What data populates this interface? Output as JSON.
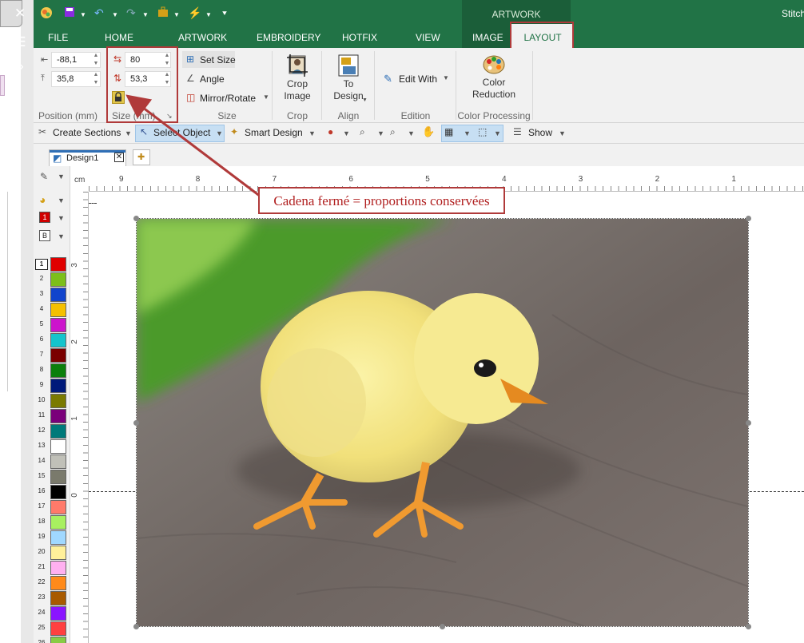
{
  "app": {
    "title_partial": "Stitch"
  },
  "tabs": [
    {
      "label": "FILE"
    },
    {
      "label": "HOME"
    },
    {
      "label": "ARTWORK"
    },
    {
      "label": "EMBROIDERY"
    },
    {
      "label": "HOTFIX"
    },
    {
      "label": "VIEW"
    },
    {
      "label": "IMAGE"
    },
    {
      "label": "LAYOUT"
    }
  ],
  "context_tab_group": "ARTWORK",
  "ribbon": {
    "position": {
      "x": "-88,1",
      "y": "35,8",
      "group_label": "Position (mm)"
    },
    "size": {
      "width": "80",
      "height": "53,3",
      "group_label": "Size (mm)",
      "lock_icon": "padlock-closed-icon"
    },
    "size_tools": {
      "set_size": "Set Size",
      "angle": "Angle",
      "mirror_rotate": "Mirror/Rotate",
      "group_label": "Size"
    },
    "crop": {
      "button_line1": "Crop",
      "button_line2": "Image",
      "group_label": "Crop"
    },
    "align": {
      "button_line1": "To",
      "button_line2": "Design",
      "group_label": "Align"
    },
    "edition": {
      "edit_with": "Edit With",
      "group_label": "Edition"
    },
    "color_processing": {
      "button_line1": "Color",
      "button_line2": "Reduction",
      "group_label": "Color Processing"
    }
  },
  "toolbar": {
    "create_sections": "Create Sections",
    "select_object": "Select Object",
    "smart_design": "Smart Design",
    "show": "Show"
  },
  "document": {
    "tab_label": "Design1"
  },
  "ruler": {
    "unit": "cm",
    "h_labels": [
      "9",
      "8",
      "7",
      "6",
      "5",
      "4",
      "3",
      "2",
      "1"
    ],
    "v_labels": [
      "3",
      "2",
      "1",
      "0"
    ]
  },
  "color_selector": {
    "value": "1",
    "b_value": "B"
  },
  "colors": [
    {
      "n": "1",
      "hex": "#e00000"
    },
    {
      "n": "2",
      "hex": "#7cbf1a"
    },
    {
      "n": "3",
      "hex": "#1144cc"
    },
    {
      "n": "4",
      "hex": "#f5c000"
    },
    {
      "n": "5",
      "hex": "#cc14cc"
    },
    {
      "n": "6",
      "hex": "#14c4cc"
    },
    {
      "n": "7",
      "hex": "#7a0000"
    },
    {
      "n": "8",
      "hex": "#0b7f0b"
    },
    {
      "n": "9",
      "hex": "#001a7a"
    },
    {
      "n": "10",
      "hex": "#7a7a00"
    },
    {
      "n": "11",
      "hex": "#7a007a"
    },
    {
      "n": "12",
      "hex": "#007a7a"
    },
    {
      "n": "13",
      "hex": "#ffffff"
    },
    {
      "n": "14",
      "hex": "#c0c0b8"
    },
    {
      "n": "15",
      "hex": "#7a7a6c"
    },
    {
      "n": "16",
      "hex": "#000000"
    },
    {
      "n": "17",
      "hex": "#ff7a6a"
    },
    {
      "n": "18",
      "hex": "#a8f060"
    },
    {
      "n": "19",
      "hex": "#a0d8ff"
    },
    {
      "n": "20",
      "hex": "#fff09a"
    },
    {
      "n": "21",
      "hex": "#ffb0f0"
    },
    {
      "n": "22",
      "hex": "#ff8a1a"
    },
    {
      "n": "23",
      "hex": "#a85a00"
    },
    {
      "n": "24",
      "hex": "#8a14ff"
    },
    {
      "n": "25",
      "hex": "#ff4040"
    },
    {
      "n": "26",
      "hex": "#88cc44"
    }
  ],
  "callout": {
    "text": "Cadena fermé = proportions conservées"
  },
  "theme": {
    "ribbon_green": "#217346",
    "annotation_red": "#b01e1e"
  }
}
